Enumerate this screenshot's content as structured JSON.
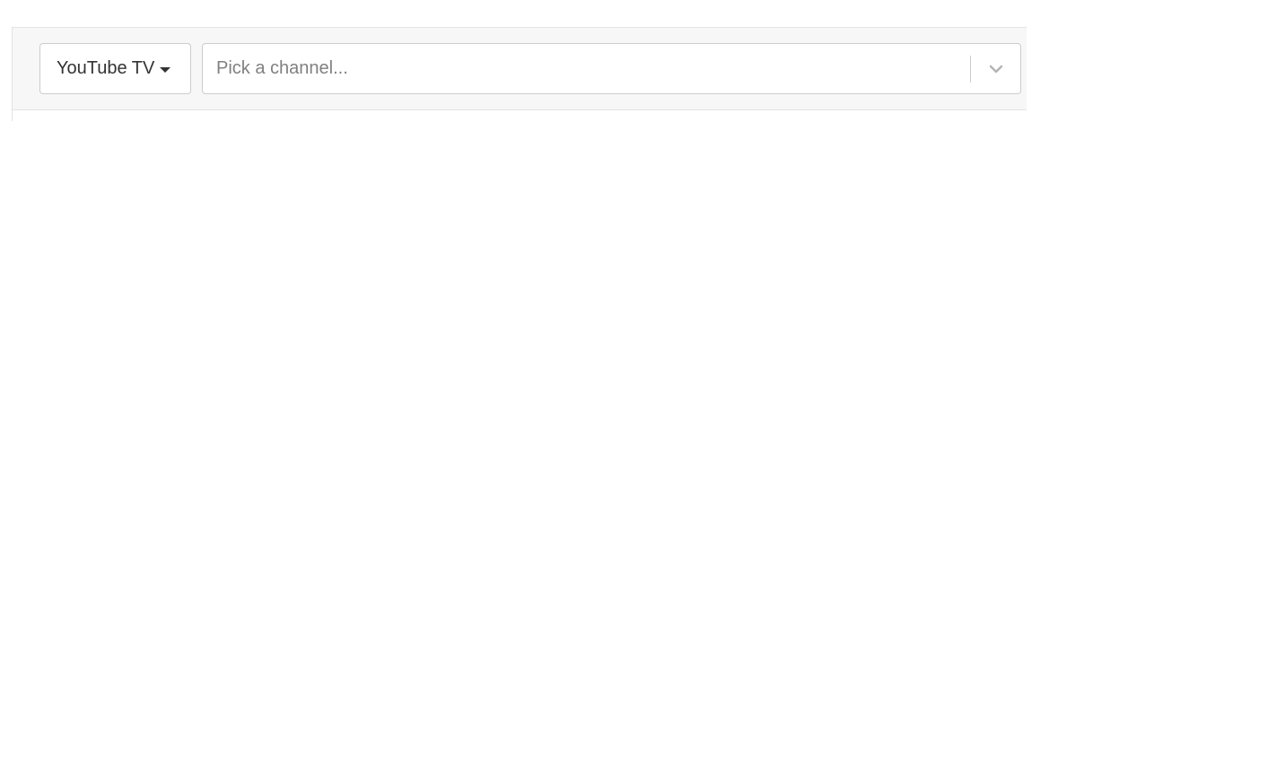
{
  "toolbar": {
    "provider": {
      "label": "YouTube TV",
      "icon": "caret-down-icon"
    },
    "channel_select": {
      "placeholder": "Pick a channel...",
      "value": "",
      "icon": "chevron-down-icon"
    }
  },
  "colors": {
    "panel_background": "#f7f7f7",
    "border": "#cccccc",
    "text": "#333333",
    "placeholder": "#808080",
    "chevron": "#b3b3b3"
  }
}
